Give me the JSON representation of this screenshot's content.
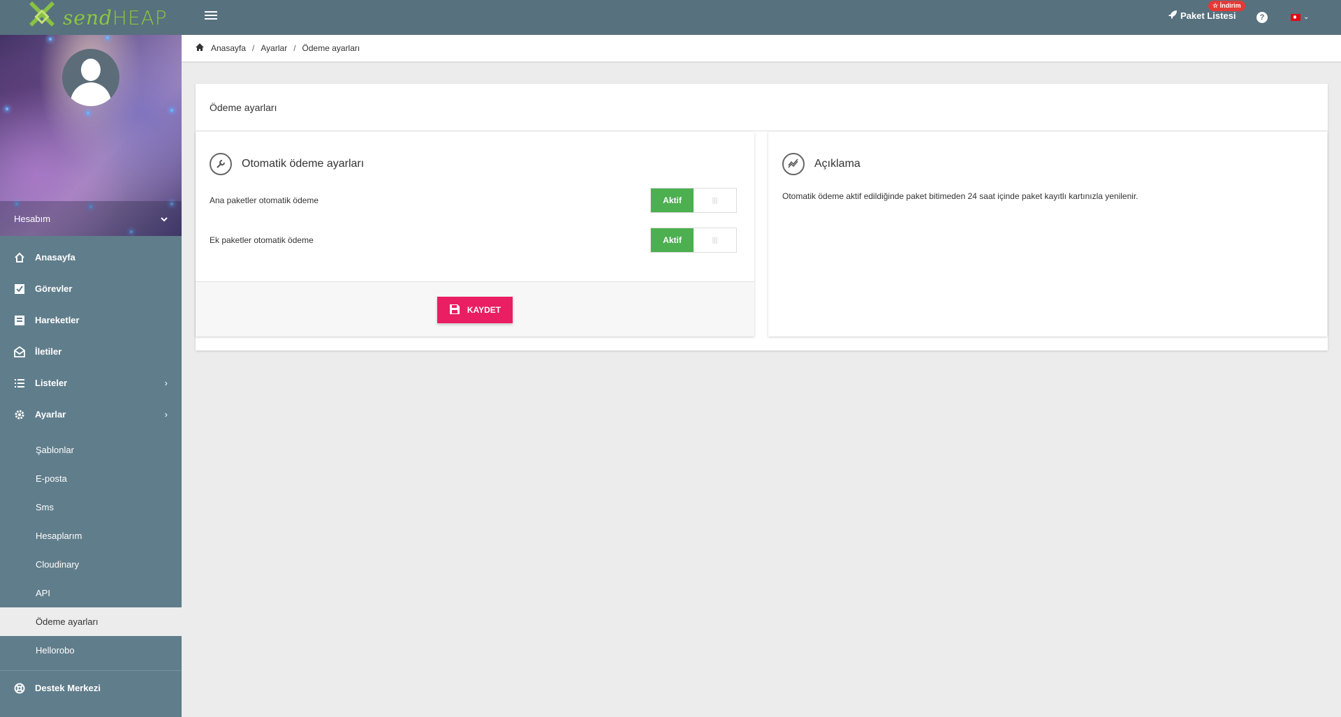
{
  "header": {
    "logo_text_a": "send",
    "logo_text_b": "HEAP",
    "package_list": "Paket Listesi",
    "discount_badge": "☆ İndirim",
    "help": "?"
  },
  "sidebar": {
    "account_label": "Hesabım",
    "items": [
      {
        "label": "Anasayfa",
        "icon": "home-icon"
      },
      {
        "label": "Görevler",
        "icon": "checkbox-icon"
      },
      {
        "label": "Hareketler",
        "icon": "receipt-icon"
      },
      {
        "label": "İletiler",
        "icon": "mail-open-icon"
      },
      {
        "label": "Listeler",
        "icon": "list-icon"
      },
      {
        "label": "Ayarlar",
        "icon": "gear-icon"
      }
    ],
    "sub_items": [
      "Şablonlar",
      "E-posta",
      "Sms",
      "Hesaplarım",
      "Cloudinary",
      "API",
      "Ödeme ayarları",
      "Hellorobo"
    ],
    "support": "Destek Merkezi"
  },
  "breadcrumb": [
    "Anasayfa",
    "Ayarlar",
    "Ödeme ayarları"
  ],
  "card": {
    "title": "Ödeme ayarları",
    "left_panel": {
      "title": "Otomatik ödeme ayarları",
      "rows": [
        {
          "label": "Ana paketler otomatik ödeme",
          "state": "Aktif"
        },
        {
          "label": "Ek paketler otomatik ödeme",
          "state": "Aktif"
        }
      ],
      "save_label": "KAYDET"
    },
    "right_panel": {
      "title": "Açıklama",
      "text": "Otomatik ödeme aktif edildiğinde paket bitimeden 24 saat içinde paket kayıtlı kartınızla yenilenir."
    }
  },
  "colors": {
    "topbar": "#57717e",
    "sidebar": "#607d8b",
    "toggle_on": "#4caf50",
    "save_button": "#e91e63",
    "badge": "#e53935"
  }
}
